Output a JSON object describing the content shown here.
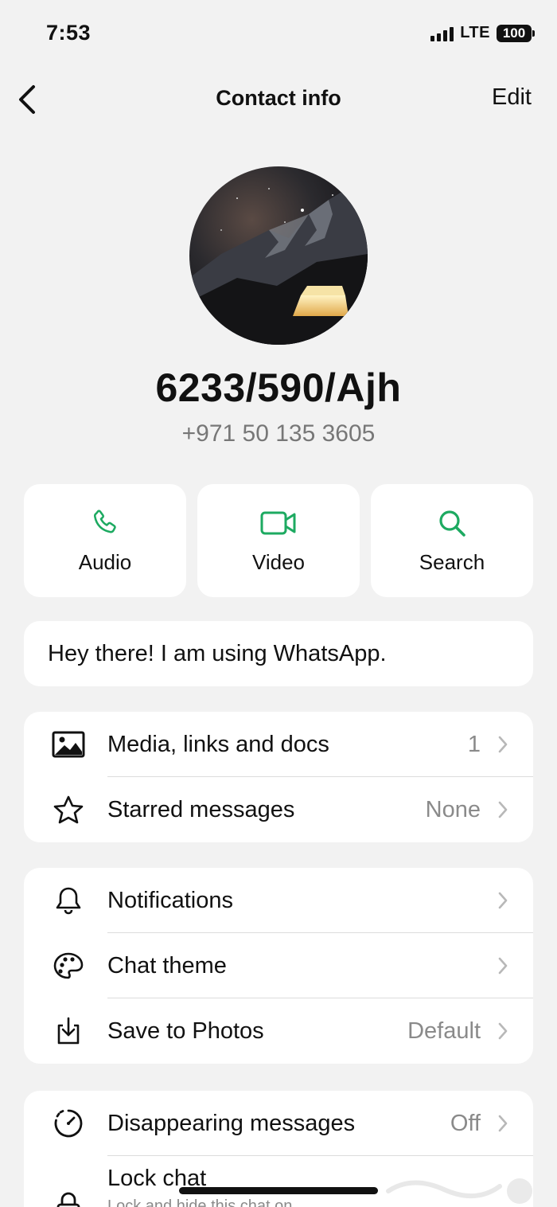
{
  "status_bar": {
    "time": "7:53",
    "network": "LTE",
    "battery": "100"
  },
  "nav": {
    "title": "Contact info",
    "edit_label": "Edit"
  },
  "contact": {
    "name": "6233/590/Ajh",
    "phone": "+971 50 135 3605"
  },
  "actions": [
    {
      "label": "Audio",
      "icon": "phone-icon"
    },
    {
      "label": "Video",
      "icon": "video-camera-icon"
    },
    {
      "label": "Search",
      "icon": "search-icon"
    }
  ],
  "about": "Hey there! I am using WhatsApp.",
  "group1": [
    {
      "label": "Media, links and docs",
      "value": "1",
      "icon": "image-icon"
    },
    {
      "label": "Starred messages",
      "value": "None",
      "icon": "star-icon"
    }
  ],
  "group2": [
    {
      "label": "Notifications",
      "value": "",
      "icon": "bell-icon"
    },
    {
      "label": "Chat theme",
      "value": "",
      "icon": "palette-icon"
    },
    {
      "label": "Save to Photos",
      "value": "Default",
      "icon": "download-icon"
    }
  ],
  "group3": [
    {
      "label": "Disappearing messages",
      "value": "Off",
      "icon": "timer-icon"
    },
    {
      "label": "Lock chat",
      "sublabel": "Lock and hide this chat on",
      "icon": "lock-icon"
    }
  ],
  "colors": {
    "accent": "#1DAA61",
    "background": "#F2F2F2",
    "card": "#FFFFFF",
    "secondary_text": "#8A8A8A"
  }
}
